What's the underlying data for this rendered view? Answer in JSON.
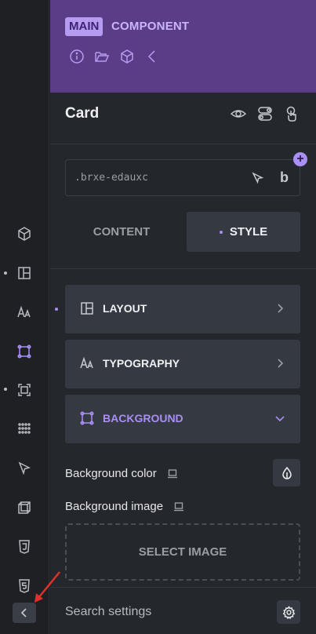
{
  "header": {
    "badge": "MAIN",
    "label": "COMPONENT",
    "icons": [
      "info-icon",
      "folder-open-icon",
      "cube-icon",
      "chevron-left-icon"
    ]
  },
  "element": {
    "title": "Card",
    "icons": [
      "eye-icon",
      "toggle-icon",
      "touch-icon"
    ]
  },
  "selector": {
    "value": ".brxe-edauxc",
    "plus": "+",
    "bold_label": "b"
  },
  "tabs": {
    "content": "CONTENT",
    "style": "STYLE",
    "active": "style"
  },
  "groups": [
    {
      "label": "LAYOUT",
      "icon": "layout-icon",
      "expanded": false
    },
    {
      "label": "TYPOGRAPHY",
      "icon": "typography-icon",
      "expanded": false
    },
    {
      "label": "BACKGROUND",
      "icon": "background-icon",
      "expanded": true
    }
  ],
  "controls": {
    "background_color": "Background color",
    "background_image": "Background image",
    "select_image": "SELECT IMAGE"
  },
  "search": {
    "placeholder": "Search settings"
  },
  "rail": {
    "icons": [
      "box-icon",
      "layout-icon",
      "typography-icon",
      "background-icon",
      "border-icon",
      "grid-dots-icon",
      "cursor-icon",
      "transform-icon",
      "css3-icon",
      "html5-icon",
      "collapse-icon"
    ],
    "active": "background-icon"
  },
  "colors": {
    "accent": "#a98ef4",
    "header_bg": "#5b3d87",
    "panel_bg": "#24272c",
    "rail_bg": "#1e2024",
    "annotation_arrow": "#e0302a"
  }
}
